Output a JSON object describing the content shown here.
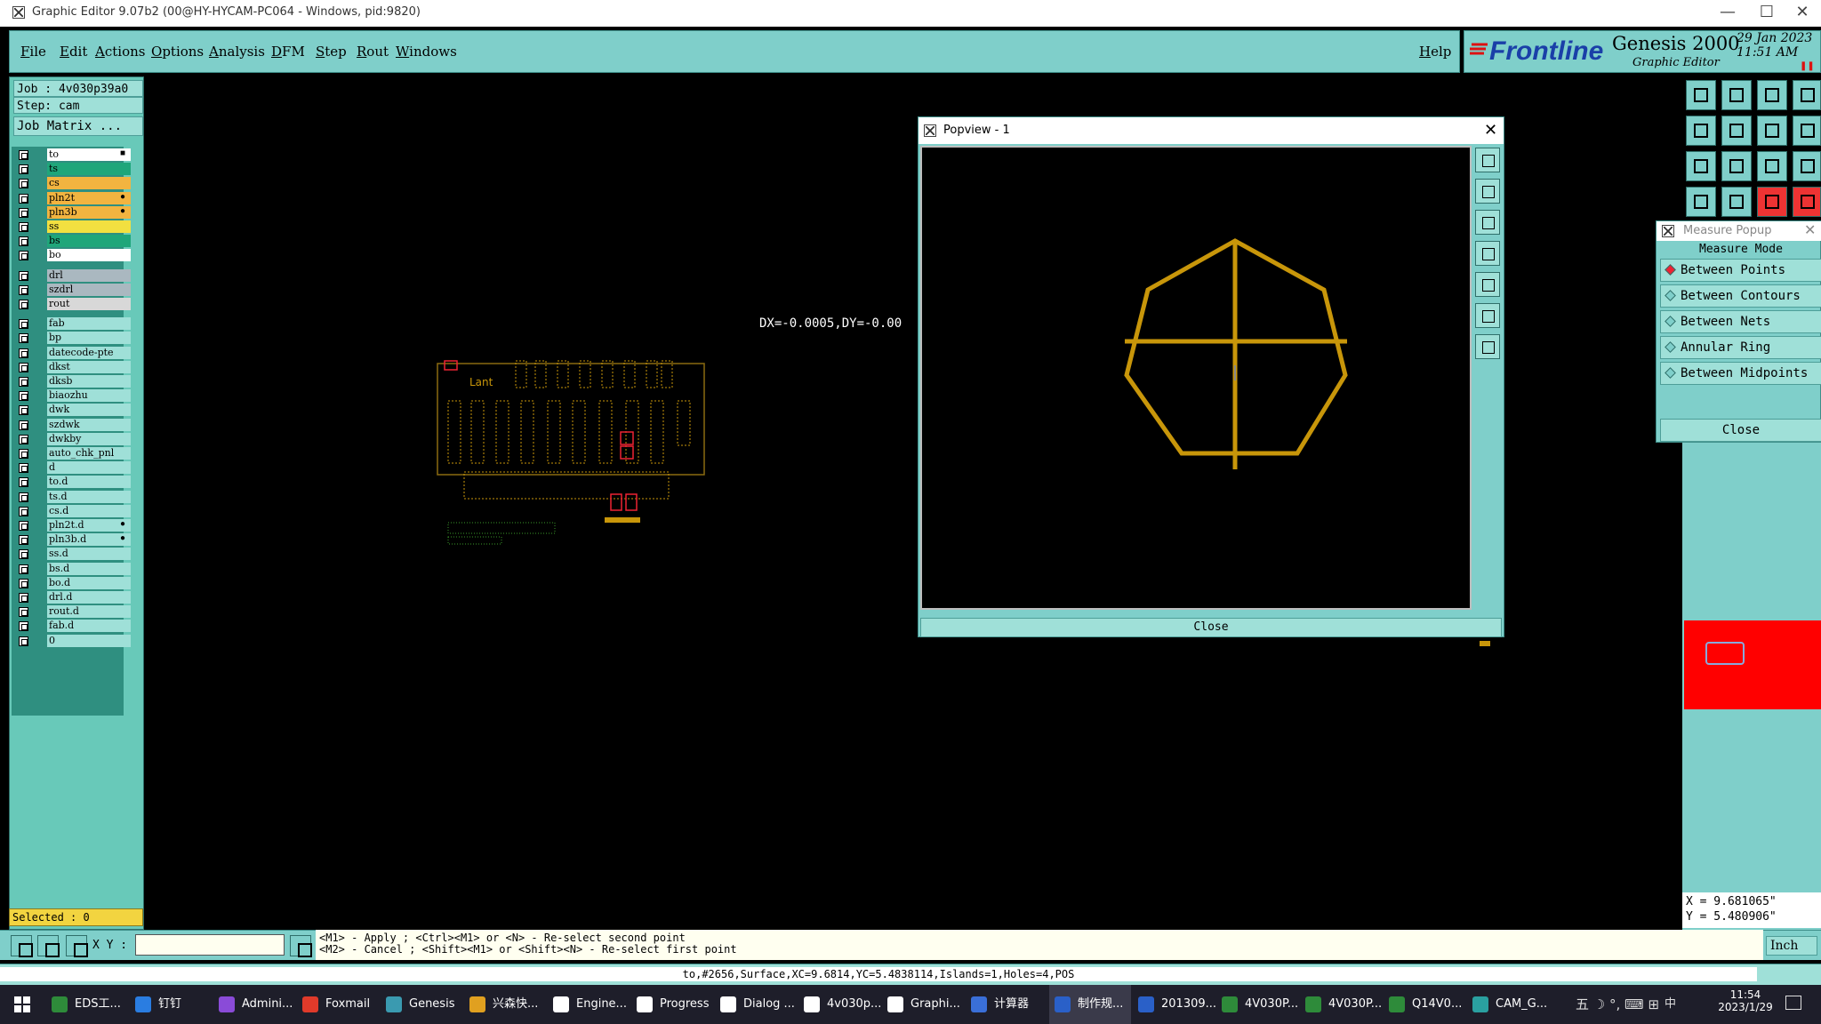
{
  "window": {
    "title": "Graphic Editor 9.07b2 (00@HY-HYCAM-PC064 - Windows, pid:9820)",
    "minimize": "—",
    "maximize": "☐",
    "close": "✕"
  },
  "menu": {
    "items": [
      "File",
      "Edit",
      "Actions",
      "Options",
      "Analysis",
      "DFM",
      "Step",
      "Rout",
      "Windows"
    ],
    "help": "Help"
  },
  "brand": {
    "logo": "Frontline",
    "product": "Genesis 2000",
    "subtitle": "Graphic Editor",
    "date": "29 Jan 2023",
    "time": "11:51 AM"
  },
  "job": {
    "job_line": "Job : 4v030p39a0",
    "step_line": "Step: cam",
    "matrix_button": "Job Matrix ..."
  },
  "layers": [
    {
      "name": "to",
      "bg": "#ffffff",
      "mark": "■"
    },
    {
      "name": "ts",
      "bg": "#1fa67a",
      "mark": ""
    },
    {
      "name": "cs",
      "bg": "#f2b440",
      "mark": ""
    },
    {
      "name": "pln2t",
      "bg": "#f2b440",
      "mark": "●"
    },
    {
      "name": "pln3b",
      "bg": "#f2b440",
      "mark": "●"
    },
    {
      "name": "ss",
      "bg": "#f2e040",
      "mark": ""
    },
    {
      "name": "bs",
      "bg": "#1fa67a",
      "mark": ""
    },
    {
      "name": "bo",
      "bg": "#ffffff",
      "mark": ""
    },
    {
      "name": "drl",
      "bg": "#aab8c0",
      "mark": ""
    },
    {
      "name": "szdrl",
      "bg": "#aab8c0",
      "mark": ""
    },
    {
      "name": "rout",
      "bg": "#d8d8d8",
      "mark": ""
    },
    {
      "name": "fab",
      "bg": "#9fe0d8",
      "mark": ""
    },
    {
      "name": "bp",
      "bg": "#9fe0d8",
      "mark": ""
    },
    {
      "name": "datecode-pte",
      "bg": "#9fe0d8",
      "mark": ""
    },
    {
      "name": "dkst",
      "bg": "#9fe0d8",
      "mark": ""
    },
    {
      "name": "dksb",
      "bg": "#9fe0d8",
      "mark": ""
    },
    {
      "name": "biaozhu",
      "bg": "#9fe0d8",
      "mark": ""
    },
    {
      "name": "dwk",
      "bg": "#9fe0d8",
      "mark": ""
    },
    {
      "name": "szdwk",
      "bg": "#9fe0d8",
      "mark": ""
    },
    {
      "name": "dwkby",
      "bg": "#9fe0d8",
      "mark": ""
    },
    {
      "name": "auto_chk_pnl",
      "bg": "#9fe0d8",
      "mark": ""
    },
    {
      "name": "d",
      "bg": "#9fe0d8",
      "mark": ""
    },
    {
      "name": "to.d",
      "bg": "#9fe0d8",
      "mark": ""
    },
    {
      "name": "ts.d",
      "bg": "#9fe0d8",
      "mark": ""
    },
    {
      "name": "cs.d",
      "bg": "#9fe0d8",
      "mark": ""
    },
    {
      "name": "pln2t.d",
      "bg": "#9fe0d8",
      "mark": "●"
    },
    {
      "name": "pln3b.d",
      "bg": "#9fe0d8",
      "mark": "●"
    },
    {
      "name": "ss.d",
      "bg": "#9fe0d8",
      "mark": ""
    },
    {
      "name": "bs.d",
      "bg": "#9fe0d8",
      "mark": ""
    },
    {
      "name": "bo.d",
      "bg": "#9fe0d8",
      "mark": ""
    },
    {
      "name": "drl.d",
      "bg": "#9fe0d8",
      "mark": ""
    },
    {
      "name": "rout.d",
      "bg": "#9fe0d8",
      "mark": ""
    },
    {
      "name": "fab.d",
      "bg": "#9fe0d8",
      "mark": ""
    },
    {
      "name": "0",
      "bg": "#9fe0d8",
      "mark": ""
    }
  ],
  "selected": "Selected : 0",
  "canvas": {
    "measure_text": "DX=-0.0005,DY=-0.00",
    "board_logo": "Lant"
  },
  "popview": {
    "title": "Popview - 1",
    "close_label": "Close",
    "shape_color": "#c8960a"
  },
  "measure_popup": {
    "title": "Measure Popup",
    "mode_label": "Measure Mode",
    "options": [
      {
        "label": "Between Points",
        "selected": true
      },
      {
        "label": "Between Contours",
        "selected": false
      },
      {
        "label": "Between Nets",
        "selected": false
      },
      {
        "label": "Annular Ring",
        "selected": false
      },
      {
        "label": "Between Midpoints",
        "selected": false
      }
    ],
    "close_label": "Close"
  },
  "coords": {
    "x": "X = 9.681065\"",
    "y": "Y = 5.480906\""
  },
  "bottom": {
    "xy_label": "X Y :",
    "xy_value": "",
    "hint_line1": "<M1> - Apply  ; <Ctrl><M1> or <N> - Re-select second point",
    "hint_line2": "<M2> - Cancel ; <Shift><M1> or <Shift><N> - Re-select first point",
    "units": "Inch"
  },
  "status_text": "to,#2656,Surface,XC=9.6814,YC=5.4838114,Islands=1,Holes=4,POS",
  "taskbar": {
    "items": [
      {
        "label": "EDS工...",
        "color": "#2e8b3a"
      },
      {
        "label": "钉钉",
        "color": "#2a7de1"
      },
      {
        "label": "Admini...",
        "color": "#8a4bd8"
      },
      {
        "label": "Foxmail",
        "color": "#e03a2a"
      },
      {
        "label": "Genesis",
        "color": "#3a9ab0"
      },
      {
        "label": "兴森快...",
        "color": "#e0a020"
      },
      {
        "label": "Engine...",
        "color": "#ffffff"
      },
      {
        "label": "Progress",
        "color": "#ffffff"
      },
      {
        "label": "Dialog ...",
        "color": "#ffffff"
      },
      {
        "label": "4v030p...",
        "color": "#ffffff"
      },
      {
        "label": "Graphi...",
        "color": "#ffffff"
      },
      {
        "label": "计算器",
        "color": "#3a6fd8"
      },
      {
        "label": "制作规...",
        "color": "#2a60c8"
      },
      {
        "label": "201309...",
        "color": "#2a60c8"
      },
      {
        "label": "4V030P...",
        "color": "#2e8b3a"
      },
      {
        "label": "4V030P...",
        "color": "#2e8b3a"
      },
      {
        "label": "Q14V0...",
        "color": "#2e8b3a"
      },
      {
        "label": "CAM_G...",
        "color": "#2aa0a0"
      }
    ],
    "tray": "五 ☽ °, ⌨ ⊞",
    "ime": "中",
    "clock_time": "11:54",
    "clock_date": "2023/1/29"
  }
}
